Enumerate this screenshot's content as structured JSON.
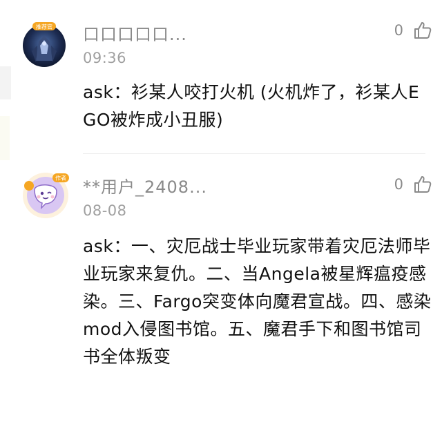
{
  "comments": [
    {
      "username": "口口口口口...",
      "time": "09:36",
      "likes": "0",
      "text": "ask：衫某人咬打火机 (火机炸了，衫某人EGO被炸成小丑服)",
      "avatar_badge": "推荐官",
      "avatar_icon": "armored-character-avatar"
    },
    {
      "username": "**用户_2408...",
      "time": "08-08",
      "likes": "0",
      "text": "ask：一、灾厄战士毕业玩家带着灾厄法师毕业玩家来复仇。二、当Angela被星辉瘟疫感染。三、Fargo突变体向魔君宣战。四、感染mod入侵图书馆。五、魔君手下和图书馆司书全体叛变",
      "avatar_badge": "作者",
      "avatar_icon": "purple-cartoon-avatar"
    }
  ],
  "colors": {
    "username": "#8a8a8a",
    "time": "#a0a0a0",
    "text": "#111111",
    "divider": "#ececec",
    "badge_orange": "#f5a623"
  }
}
